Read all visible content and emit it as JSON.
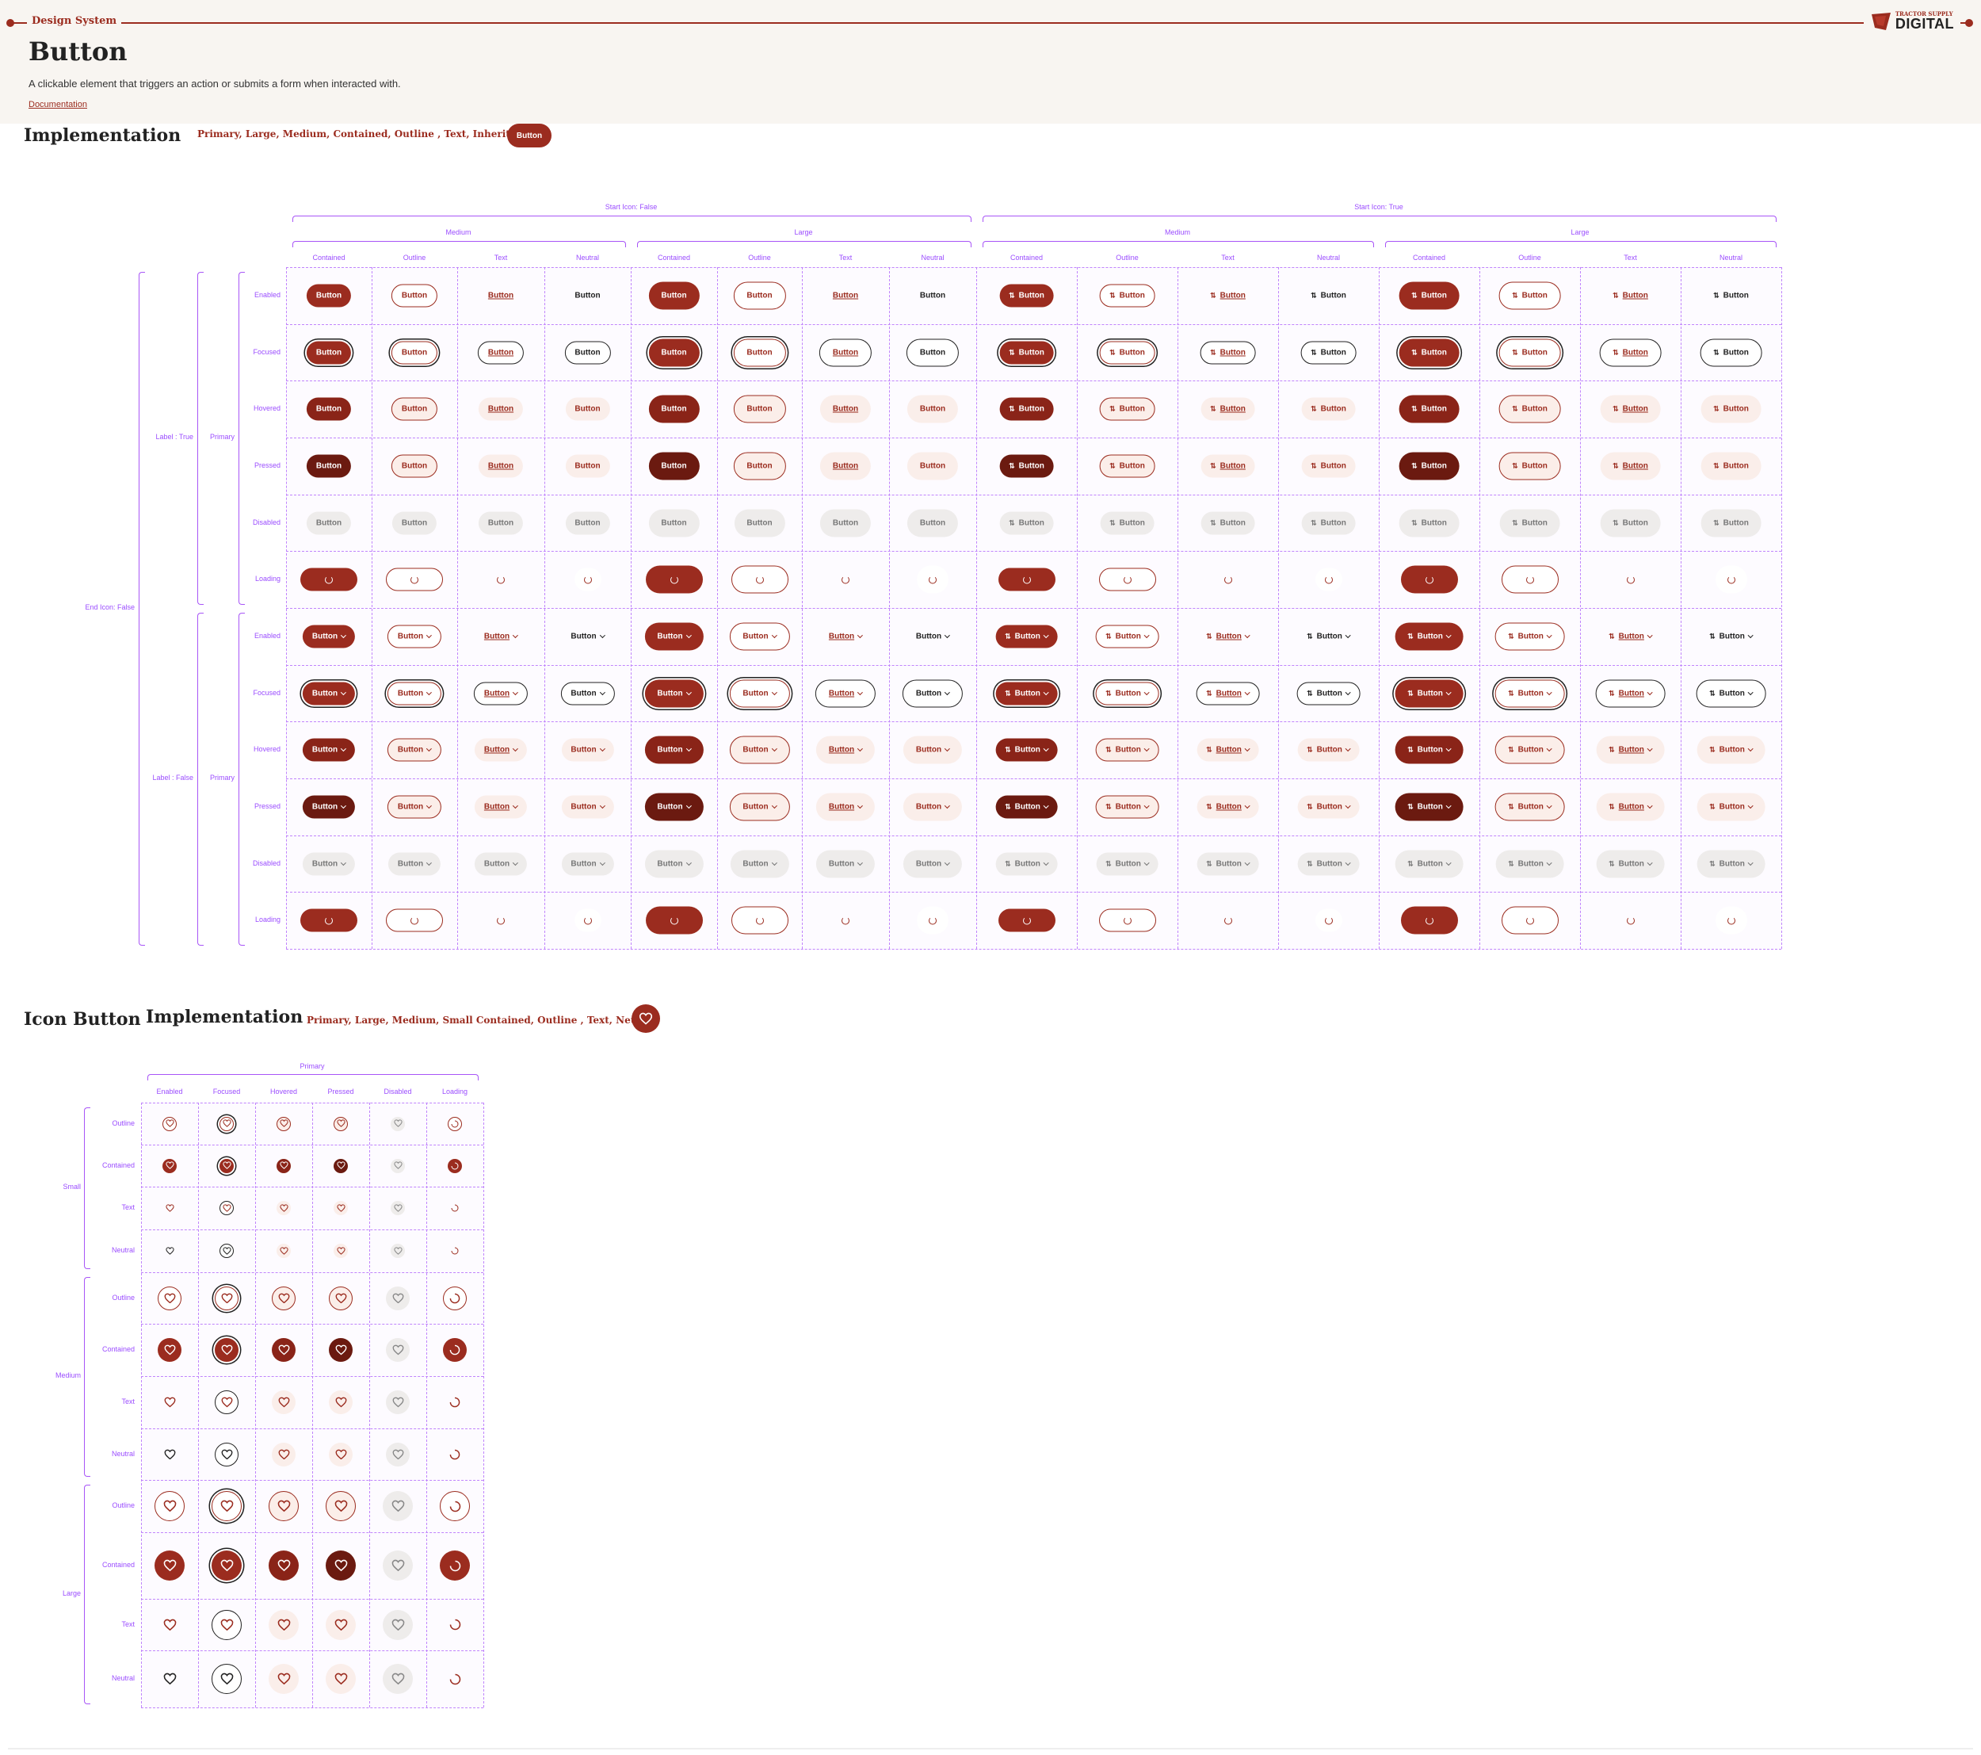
{
  "header": {
    "section_label": "Design System",
    "title": "Button",
    "subtitle": "A clickable element that triggers an action or submits a form when interacted with.",
    "doc_link": "Documentation",
    "logo_small": "TRACTOR SUPPLY",
    "logo_big": "DIGITAL"
  },
  "button_section": {
    "title": "Implementation",
    "variants": "Primary, Large, Medium,  Contained, Outline , Text, Inherit Text",
    "demo_label": "Button"
  },
  "matrix": {
    "start_icon_false": "Start Icon: False",
    "start_icon_true": "Start Icon: True",
    "medium": "Medium",
    "large": "Large",
    "columns": [
      "Contained",
      "Outline",
      "Text",
      "Neutral",
      "Contained",
      "Outline",
      "Text",
      "Neutral",
      "Contained",
      "Outline",
      "Text",
      "Neutral",
      "Contained",
      "Outline",
      "Text",
      "Neutral"
    ],
    "states": [
      "Enabled",
      "Focused",
      "Hovered",
      "Pressed",
      "Disabled",
      "Loading",
      "Enabled",
      "Focused",
      "Hovered",
      "Pressed",
      "Disabled",
      "Loading"
    ],
    "end_icon_false": "End Icon: False",
    "label_true": "Label : True",
    "label_false": "Label : False",
    "primary": "Primary",
    "button_label": "Button"
  },
  "icon_section": {
    "title": "Icon Button",
    "impl": "Implementation",
    "variants": "Primary, Large, Medium, Small Contained, Outline , Text, Neutral",
    "primary": "Primary",
    "columns": [
      "Enabled",
      "Focused",
      "Hovered",
      "Pressed",
      "Disabled",
      "Loading"
    ],
    "row_types": [
      "Outline",
      "Contained",
      "Text",
      "Neutral"
    ],
    "sizes": [
      "Small",
      "Medium",
      "Large"
    ]
  },
  "colors": {
    "brand": "#9b2c1f",
    "brand_hover": "#8a2418",
    "brand_pressed": "#6b1a10",
    "annotation": "#a855f7",
    "disabled_bg": "#eeeceb"
  },
  "icons": [
    "heart-icon",
    "arrows-up-down-icon",
    "chevron-down-icon",
    "spinner-icon"
  ]
}
